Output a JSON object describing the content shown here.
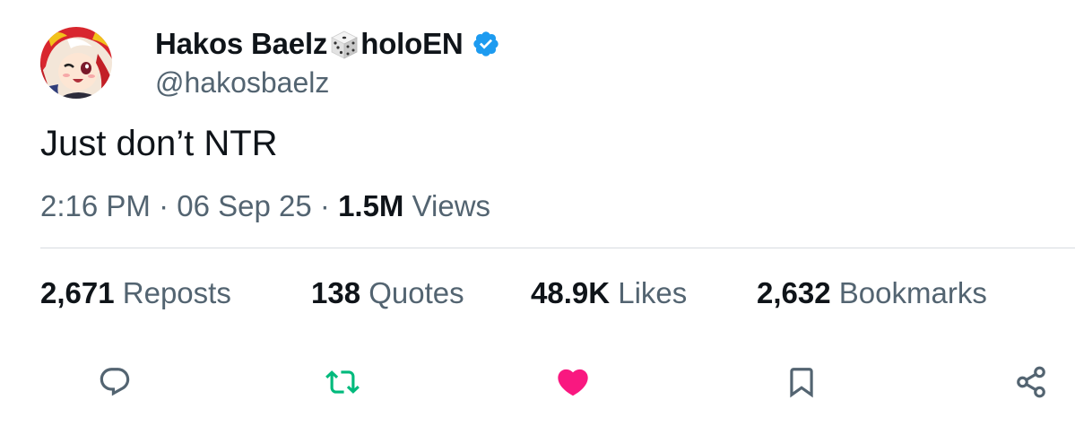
{
  "author": {
    "name_prefix": "Hakos Baelz",
    "name_suffix": "holoEN",
    "handle": "@hakosbaelz",
    "verified": true
  },
  "tweet": {
    "text": "Just don’t NTR",
    "time": "2:16 PM",
    "separator": "·",
    "date": "06 Sep 25",
    "views_count": "1.5M",
    "views_label": "Views"
  },
  "stats": {
    "reposts": {
      "count": "2,671",
      "label": "Reposts"
    },
    "quotes": {
      "count": "138",
      "label": "Quotes"
    },
    "likes": {
      "count": "48.9K",
      "label": "Likes"
    },
    "bookmarks": {
      "count": "2,632",
      "label": "Bookmarks"
    }
  },
  "actions": {
    "reply_icon": "reply-icon",
    "repost_icon": "repost-icon",
    "like_icon": "heart-icon",
    "bookmark_icon": "bookmark-icon",
    "share_icon": "share-icon"
  },
  "colors": {
    "text_primary": "#0f1419",
    "text_secondary": "#536471",
    "verified_blue": "#1d9bf0",
    "repost_green": "#00ba7c",
    "like_pink": "#f91880",
    "divider": "#d7dce0"
  }
}
